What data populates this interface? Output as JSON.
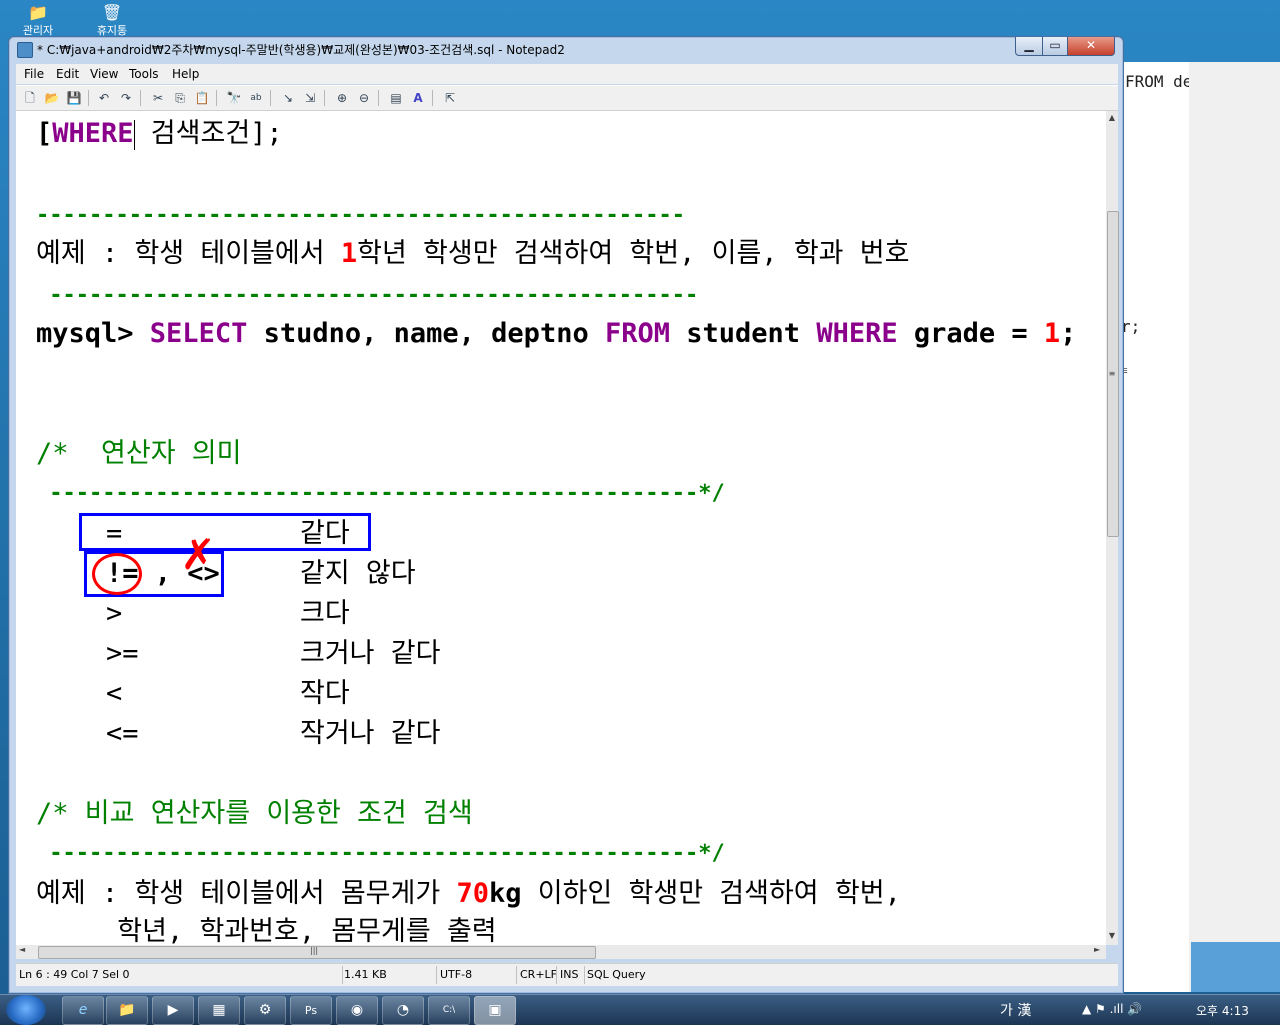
{
  "desktop": {
    "icons": [
      {
        "label": "관리자",
        "glyph": "📁"
      },
      {
        "label": "휴지통",
        "glyph": "🗑"
      }
    ]
  },
  "background_window": {
    "line1": " FROM department",
    "line2": "r;",
    "handle": "≡"
  },
  "window": {
    "title": "* C:₩java+android₩2주차₩mysql-주말반(학생용)₩교제(완성본)₩03-조건검색.sql - Notepad2",
    "controls": {
      "minimize": "▁",
      "maximize": "▭",
      "close": "✕"
    }
  },
  "menu": [
    "File",
    "Edit",
    "View",
    "Tools",
    "Help"
  ],
  "toolbar": [
    {
      "name": "new-icon",
      "glyph": "🗋"
    },
    {
      "name": "open-icon",
      "glyph": "📂"
    },
    {
      "name": "save-icon",
      "glyph": "💾"
    },
    {
      "name": "undo-icon",
      "glyph": "↶"
    },
    {
      "name": "redo-icon",
      "glyph": "↷"
    },
    {
      "name": "cut-icon",
      "glyph": "✂"
    },
    {
      "name": "copy-icon",
      "glyph": "⎘"
    },
    {
      "name": "paste-icon",
      "glyph": "📋"
    },
    {
      "name": "find-icon",
      "glyph": "🔭"
    },
    {
      "name": "replace-icon",
      "glyph": "ab"
    },
    {
      "name": "goto-icon",
      "glyph": "↘"
    },
    {
      "name": "wordwrap-icon",
      "glyph": "⇲"
    },
    {
      "name": "zoom-in-icon",
      "glyph": "⊕"
    },
    {
      "name": "zoom-out-icon",
      "glyph": "⊖"
    },
    {
      "name": "scheme-icon",
      "glyph": "▤"
    },
    {
      "name": "font-icon",
      "glyph": "A"
    },
    {
      "name": "ontop-icon",
      "glyph": "⇱"
    }
  ],
  "editor": {
    "line1": {
      "open": "[",
      "kw": "WHERE",
      "rest": " 검색조건];"
    },
    "dash1": "-------------------------------------------------",
    "example1": {
      "pre": "예제 : 학생 테이블에서 ",
      "num": "1",
      "post": "학년 학생만 검색하여 학번, 이름, 학과 번호"
    },
    "dash2": " -------------------------------------------------",
    "sql": {
      "prompt": "mysql> ",
      "kw1": "SELECT",
      "t1": " studno, name, deptno ",
      "kw2": "FROM",
      "t2": " student ",
      "kw3": "WHERE",
      "t3": " grade = ",
      "num": "1",
      "end": ";"
    },
    "comment1": "/*  연산자 의미",
    "comment1_end": " -------------------------------------------------*/",
    "operators": [
      {
        "op": "=",
        "meaning": "같다"
      },
      {
        "op": "!= , <>",
        "meaning": "같지 않다"
      },
      {
        "op": ">",
        "meaning": "크다"
      },
      {
        "op": ">=",
        "meaning": "크거나 같다"
      },
      {
        "op": "<",
        "meaning": "작다"
      },
      {
        "op": "<=",
        "meaning": "작거나 같다"
      }
    ],
    "comment2": "/* 비교 연산자를 이용한 조건 검색",
    "comment2_end": " -------------------------------------------------*/",
    "example2": {
      "pre": "예제 : 학생 테이블에서 몸무게가 ",
      "num": "70",
      "unit": "kg",
      "post": " 이하인 학생만 검색하여 학번,"
    },
    "example2_cont": "     학년, 학과번호, 몸무게를 출력",
    "annotation_cross": "✗"
  },
  "scrollbars": {
    "up": "▲",
    "down": "▼",
    "left": "◄",
    "right": "►",
    "grip": "≡",
    "hgrip": "|||"
  },
  "status": {
    "position": "Ln 6 : 49   Col 7   Sel 0",
    "size": "1.41 KB",
    "encoding": "UTF-8",
    "eol": "CR+LF",
    "ins": "INS",
    "lexer": "SQL Query"
  },
  "taskbar": {
    "apps": [
      "e",
      "📁",
      "▶",
      "▦",
      "⚙",
      "Ps",
      "◉",
      "◔",
      "C:\\",
      "▣"
    ],
    "ime": "가 漢",
    "tray_icons": "▲  ⚑  .ıll  🔊",
    "clock": "오후 4:13"
  }
}
